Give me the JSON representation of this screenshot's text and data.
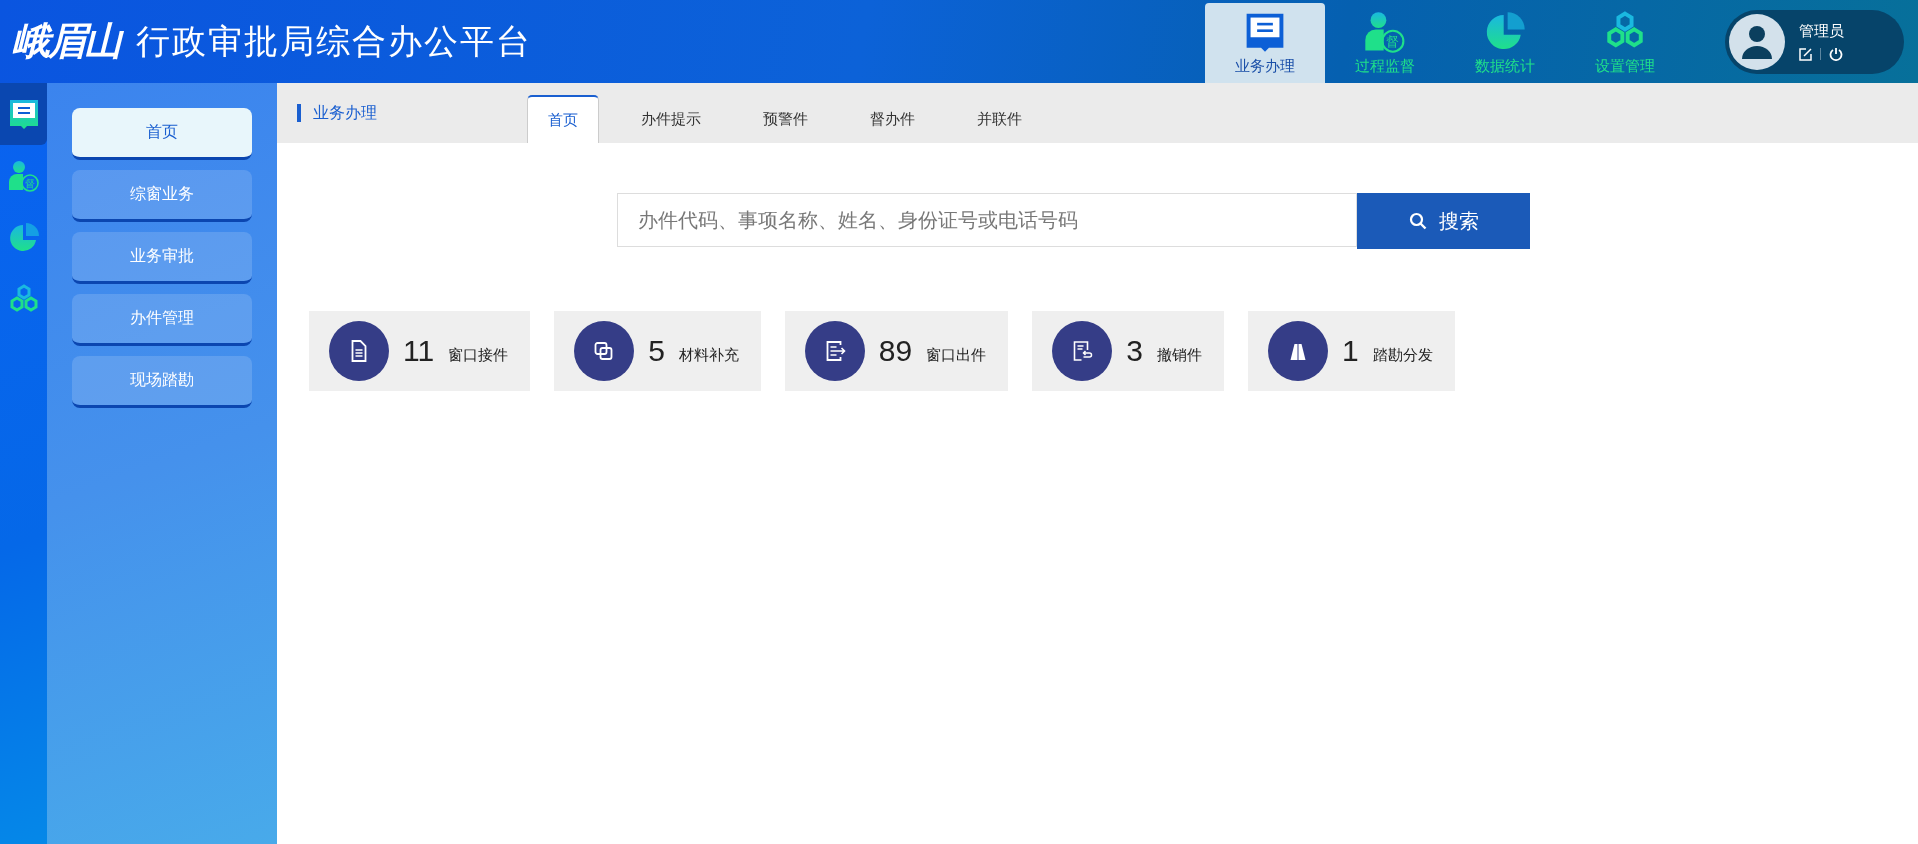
{
  "header": {
    "logo": "峨眉山",
    "title": "行政审批局综合办公平台",
    "modules": [
      {
        "label": "业务办理",
        "kind": "inbox",
        "selected": true
      },
      {
        "label": "过程监督",
        "kind": "person",
        "badge": "督",
        "selected": false
      },
      {
        "label": "数据统计",
        "kind": "pie",
        "selected": false
      },
      {
        "label": "设置管理",
        "kind": "hexagons",
        "selected": false
      }
    ],
    "user": {
      "name": "管理员"
    }
  },
  "icon_rail": [
    {
      "kind": "inbox",
      "selected": true
    },
    {
      "kind": "person",
      "badge": "督",
      "selected": false
    },
    {
      "kind": "pie",
      "selected": false
    },
    {
      "kind": "hexagons",
      "selected": false
    }
  ],
  "sidebar": {
    "items": [
      {
        "label": "首页",
        "selected": true
      },
      {
        "label": "综窗业务",
        "selected": false
      },
      {
        "label": "业务审批",
        "selected": false
      },
      {
        "label": "办件管理",
        "selected": false
      },
      {
        "label": "现场踏勘",
        "selected": false
      }
    ]
  },
  "breadcrumb": "业务办理",
  "tabs": [
    {
      "label": "首页",
      "selected": true
    },
    {
      "label": "办件提示",
      "selected": false
    },
    {
      "label": "预警件",
      "selected": false
    },
    {
      "label": "督办件",
      "selected": false
    },
    {
      "label": "并联件",
      "selected": false
    }
  ],
  "search": {
    "placeholder": "办件代码、事项名称、姓名、身份证号或电话号码",
    "button": "搜索"
  },
  "stats": [
    {
      "count": "11",
      "label": "窗口接件",
      "kind": "document"
    },
    {
      "count": "5",
      "label": "材料补充",
      "kind": "copy"
    },
    {
      "count": "89",
      "label": "窗口出件",
      "kind": "export"
    },
    {
      "count": "3",
      "label": "撤销件",
      "kind": "undo"
    },
    {
      "count": "1",
      "label": "踏勘分发",
      "kind": "road"
    }
  ]
}
